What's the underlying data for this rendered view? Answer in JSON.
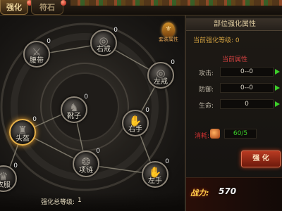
{
  "tabs": [
    {
      "label": "强化",
      "active": true
    },
    {
      "label": "符石",
      "active": false
    }
  ],
  "emblem": {
    "caption": "套装属性"
  },
  "nodes": [
    {
      "id": "belt",
      "name": "腰带",
      "level": "0",
      "icon": "belt-icon",
      "selected": false
    },
    {
      "id": "ring-right",
      "name": "右戒",
      "level": "0",
      "icon": "ring-icon",
      "selected": false
    },
    {
      "id": "ring-left",
      "name": "左戒",
      "level": "0",
      "icon": "ring-icon",
      "selected": false
    },
    {
      "id": "shoes",
      "name": "靴子",
      "level": "0",
      "icon": "boots-icon",
      "selected": false
    },
    {
      "id": "hand-right",
      "name": "右手",
      "level": "0",
      "icon": "bracer-icon",
      "selected": false
    },
    {
      "id": "helmet",
      "name": "头盔",
      "level": "0",
      "icon": "helmet-icon",
      "selected": true
    },
    {
      "id": "necklace",
      "name": "项链",
      "level": "0",
      "icon": "necklace-icon",
      "selected": false
    },
    {
      "id": "hand-left",
      "name": "左手",
      "level": "0",
      "icon": "bracer-icon",
      "selected": false
    },
    {
      "id": "armor",
      "name": "衣服",
      "level": "0",
      "icon": "armor-icon",
      "selected": false
    }
  ],
  "total_level": {
    "label": "强化总等级:",
    "value": "1"
  },
  "panel": {
    "title": "部位强化属性",
    "current_level": "当前强化等级: 0",
    "current_attrs_title": "当前属性",
    "attrs": [
      {
        "key": "攻击:",
        "value": "0--0"
      },
      {
        "key": "防御:",
        "value": "0--0"
      },
      {
        "key": "生命:",
        "value": "0"
      }
    ],
    "cost": {
      "label": "消耗:",
      "value": "60/5"
    },
    "strengthen_label": "强 化",
    "power": {
      "label": "战力:",
      "value": "570"
    }
  },
  "colors": {
    "accent": "#e8b24a",
    "positive": "#3ccf2a",
    "button": "#b83a22"
  }
}
